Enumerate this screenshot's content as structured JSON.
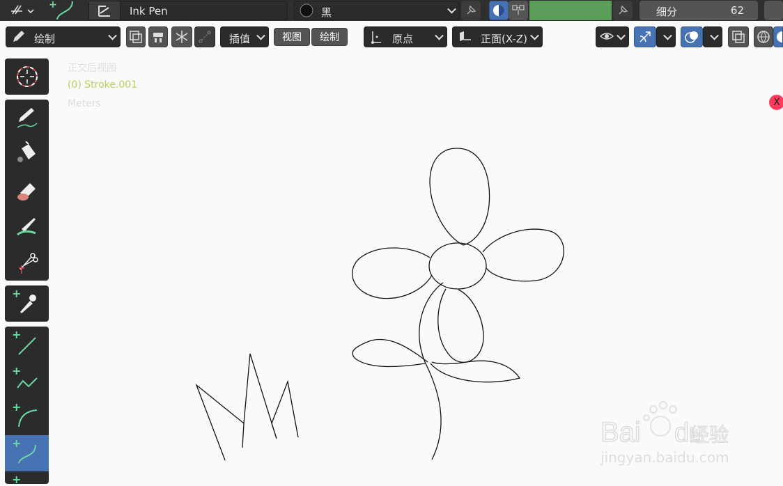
{
  "header": {
    "brush_name": "Ink Pen",
    "material_name": "黑",
    "subdivision_label": "细分",
    "subdivision_value": "62"
  },
  "toolbar": {
    "mode": "绘制",
    "interpolate": "插值",
    "view": "视图",
    "draw": "绘制",
    "origin": "原点",
    "plane": "正面(X-Z)"
  },
  "overlay": {
    "view_name": "正交后视图",
    "object_name": "(0) Stroke.001",
    "units": "Meters"
  },
  "tools": [
    {
      "name": "cursor-tool"
    },
    {
      "name": "draw-tool"
    },
    {
      "name": "fill-tool"
    },
    {
      "name": "erase-tool"
    },
    {
      "name": "tint-tool"
    },
    {
      "name": "cutter-tool"
    },
    {
      "name": "eyedropper-tool"
    },
    {
      "name": "line-tool"
    },
    {
      "name": "polyline-tool"
    },
    {
      "name": "arc-tool"
    },
    {
      "name": "curve-tool"
    }
  ],
  "colors": {
    "header_bg": "#2f2f2f",
    "active_blue": "#4772b3",
    "green_swatch": "#5a9e5a",
    "object_name": "#b5cf5a",
    "close_badge": "#ff3b5c"
  },
  "watermark": {
    "brand": "Bai du 经验",
    "url": "jingyan.baidu.com"
  },
  "close_badge_label": "X"
}
